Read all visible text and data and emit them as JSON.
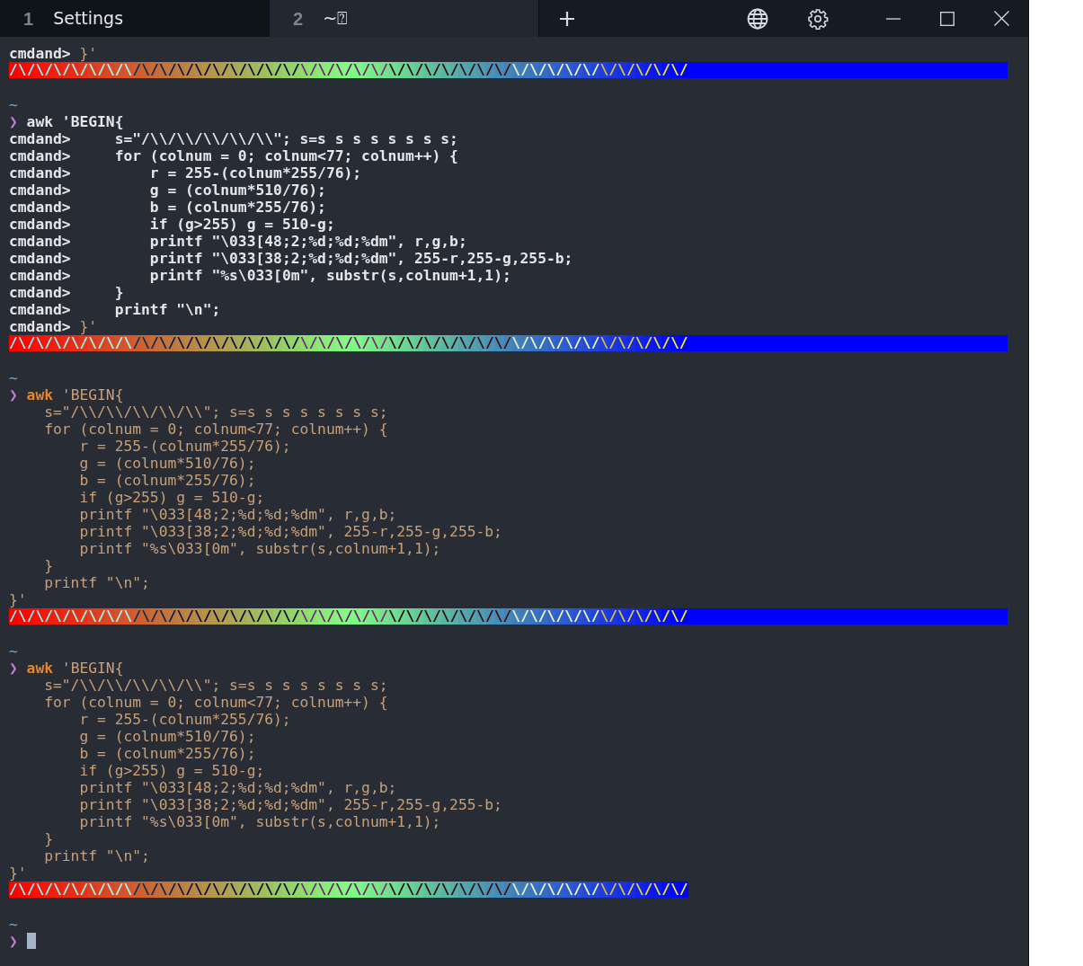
{
  "tabs": [
    {
      "number": "1",
      "title": "Settings",
      "selected": false
    },
    {
      "number": "2",
      "title": "~⍰",
      "selected": true
    }
  ],
  "lines": [
    {
      "kind": "text",
      "segments": [
        {
          "text": "cmdand>",
          "kind": "label"
        },
        {
          "text": " }'",
          "kind": "brace"
        }
      ]
    },
    {
      "kind": "bar",
      "text": "/\\/\\/\\/\\/\\/\\/\\/\\/\\/\\/\\/\\/\\/\\/\\/\\/\\/\\/\\/\\/\\/\\/\\/\\/\\/\\/\\/\\/\\/\\/\\/\\/\\/\\/\\/\\/\\/\\/",
      "fill": true
    },
    {
      "kind": "blank"
    },
    {
      "kind": "text",
      "segments": [
        {
          "text": "~",
          "kind": "dir"
        }
      ]
    },
    {
      "kind": "text",
      "segments": [
        {
          "text": "❯",
          "kind": "chevron"
        },
        {
          "text": " awk 'BEGIN{",
          "kind": "plain"
        }
      ]
    },
    {
      "kind": "text",
      "segments": [
        {
          "text": "cmdand>",
          "kind": "label"
        },
        {
          "text": "     s=\"/\\\\/\\\\/\\\\/\\\\/\\\\\"; s=s s s s s s s s;",
          "kind": "plain"
        }
      ]
    },
    {
      "kind": "text",
      "segments": [
        {
          "text": "cmdand>",
          "kind": "label"
        },
        {
          "text": "     for (colnum = 0; colnum<77; colnum++) {",
          "kind": "plain"
        }
      ]
    },
    {
      "kind": "text",
      "segments": [
        {
          "text": "cmdand>",
          "kind": "label"
        },
        {
          "text": "         r = 255-(colnum*255/76);",
          "kind": "plain"
        }
      ]
    },
    {
      "kind": "text",
      "segments": [
        {
          "text": "cmdand>",
          "kind": "label"
        },
        {
          "text": "         g = (colnum*510/76);",
          "kind": "plain"
        }
      ]
    },
    {
      "kind": "text",
      "segments": [
        {
          "text": "cmdand>",
          "kind": "label"
        },
        {
          "text": "         b = (colnum*255/76);",
          "kind": "plain"
        }
      ]
    },
    {
      "kind": "text",
      "segments": [
        {
          "text": "cmdand>",
          "kind": "label"
        },
        {
          "text": "         if (g>255) g = 510-g;",
          "kind": "plain"
        }
      ]
    },
    {
      "kind": "text",
      "segments": [
        {
          "text": "cmdand>",
          "kind": "label"
        },
        {
          "text": "         printf \"\\033[48;2;%d;%d;%dm\", r,g,b;",
          "kind": "plain"
        }
      ]
    },
    {
      "kind": "text",
      "segments": [
        {
          "text": "cmdand>",
          "kind": "label"
        },
        {
          "text": "         printf \"\\033[38;2;%d;%d;%dm\", 255-r,255-g,255-b;",
          "kind": "plain"
        }
      ]
    },
    {
      "kind": "text",
      "segments": [
        {
          "text": "cmdand>",
          "kind": "label"
        },
        {
          "text": "         printf \"%s\\033[0m\", substr(s,colnum+1,1);",
          "kind": "plain"
        }
      ]
    },
    {
      "kind": "text",
      "segments": [
        {
          "text": "cmdand>",
          "kind": "label"
        },
        {
          "text": "     }",
          "kind": "plain"
        }
      ]
    },
    {
      "kind": "text",
      "segments": [
        {
          "text": "cmdand>",
          "kind": "label"
        },
        {
          "text": "     printf \"\\n\";",
          "kind": "plain"
        }
      ]
    },
    {
      "kind": "text",
      "segments": [
        {
          "text": "cmdand>",
          "kind": "label"
        },
        {
          "text": " }'",
          "kind": "brace"
        }
      ]
    },
    {
      "kind": "bar",
      "text": "/\\/\\/\\/\\/\\/\\/\\/\\/\\/\\/\\/\\/\\/\\/\\/\\/\\/\\/\\/\\/\\/\\/\\/\\/\\/\\/\\/\\/\\/\\/\\/\\/\\/\\/\\/\\/\\/\\/",
      "fill": true
    },
    {
      "kind": "blank"
    },
    {
      "kind": "text",
      "segments": [
        {
          "text": "~",
          "kind": "dir"
        }
      ]
    },
    {
      "kind": "text",
      "segments": [
        {
          "text": "❯",
          "kind": "chevron"
        },
        {
          "text": " awk",
          "kind": "command"
        },
        {
          "text": " 'BEGIN{",
          "kind": "arg"
        }
      ]
    },
    {
      "kind": "text",
      "segments": [
        {
          "text": "    s=\"/\\\\/\\\\/\\\\/\\\\/\\\\\"; s=s s s s s s s s;",
          "kind": "arg"
        }
      ]
    },
    {
      "kind": "text",
      "segments": [
        {
          "text": "    for (colnum = 0; colnum<77; colnum++) {",
          "kind": "arg"
        }
      ]
    },
    {
      "kind": "text",
      "segments": [
        {
          "text": "        r = 255-(colnum*255/76);",
          "kind": "arg"
        }
      ]
    },
    {
      "kind": "text",
      "segments": [
        {
          "text": "        g = (colnum*510/76);",
          "kind": "arg"
        }
      ]
    },
    {
      "kind": "text",
      "segments": [
        {
          "text": "        b = (colnum*255/76);",
          "kind": "arg"
        }
      ]
    },
    {
      "kind": "text",
      "segments": [
        {
          "text": "        if (g>255) g = 510-g;",
          "kind": "arg"
        }
      ]
    },
    {
      "kind": "text",
      "segments": [
        {
          "text": "        printf \"\\033[48;2;%d;%d;%dm\", r,g,b;",
          "kind": "arg"
        }
      ]
    },
    {
      "kind": "text",
      "segments": [
        {
          "text": "        printf \"\\033[38;2;%d;%d;%dm\", 255-r,255-g,255-b;",
          "kind": "arg"
        }
      ]
    },
    {
      "kind": "text",
      "segments": [
        {
          "text": "        printf \"%s\\033[0m\", substr(s,colnum+1,1);",
          "kind": "arg"
        }
      ]
    },
    {
      "kind": "text",
      "segments": [
        {
          "text": "    }",
          "kind": "arg"
        }
      ]
    },
    {
      "kind": "text",
      "segments": [
        {
          "text": "    printf \"\\n\";",
          "kind": "arg"
        }
      ]
    },
    {
      "kind": "text",
      "segments": [
        {
          "text": "}'",
          "kind": "arg"
        }
      ]
    },
    {
      "kind": "bar",
      "text": "/\\/\\/\\/\\/\\/\\/\\/\\/\\/\\/\\/\\/\\/\\/\\/\\/\\/\\/\\/\\/\\/\\/\\/\\/\\/\\/\\/\\/\\/\\/\\/\\/\\/\\/\\/\\/\\/\\/",
      "fill": true
    },
    {
      "kind": "blank"
    },
    {
      "kind": "text",
      "segments": [
        {
          "text": "~",
          "kind": "dir"
        }
      ]
    },
    {
      "kind": "text",
      "segments": [
        {
          "text": "❯",
          "kind": "chevron"
        },
        {
          "text": " awk",
          "kind": "command"
        },
        {
          "text": " 'BEGIN{",
          "kind": "arg"
        }
      ]
    },
    {
      "kind": "text",
      "segments": [
        {
          "text": "    s=\"/\\\\/\\\\/\\\\/\\\\/\\\\\"; s=s s s s s s s s;",
          "kind": "arg"
        }
      ]
    },
    {
      "kind": "text",
      "segments": [
        {
          "text": "    for (colnum = 0; colnum<77; colnum++) {",
          "kind": "arg"
        }
      ]
    },
    {
      "kind": "text",
      "segments": [
        {
          "text": "        r = 255-(colnum*255/76);",
          "kind": "arg"
        }
      ]
    },
    {
      "kind": "text",
      "segments": [
        {
          "text": "        g = (colnum*510/76);",
          "kind": "arg"
        }
      ]
    },
    {
      "kind": "text",
      "segments": [
        {
          "text": "        b = (colnum*255/76);",
          "kind": "arg"
        }
      ]
    },
    {
      "kind": "text",
      "segments": [
        {
          "text": "        if (g>255) g = 510-g;",
          "kind": "arg"
        }
      ]
    },
    {
      "kind": "text",
      "segments": [
        {
          "text": "        printf \"\\033[48;2;%d;%d;%dm\", r,g,b;",
          "kind": "arg"
        }
      ]
    },
    {
      "kind": "text",
      "segments": [
        {
          "text": "        printf \"\\033[38;2;%d;%d;%dm\", 255-r,255-g,255-b;",
          "kind": "arg"
        }
      ]
    },
    {
      "kind": "text",
      "segments": [
        {
          "text": "        printf \"%s\\033[0m\", substr(s,colnum+1,1);",
          "kind": "arg"
        }
      ]
    },
    {
      "kind": "text",
      "segments": [
        {
          "text": "    }",
          "kind": "arg"
        }
      ]
    },
    {
      "kind": "text",
      "segments": [
        {
          "text": "    printf \"\\n\";",
          "kind": "arg"
        }
      ]
    },
    {
      "kind": "text",
      "segments": [
        {
          "text": "}'",
          "kind": "arg"
        }
      ]
    },
    {
      "kind": "bar",
      "text": "/\\/\\/\\/\\/\\/\\/\\/\\/\\/\\/\\/\\/\\/\\/\\/\\/\\/\\/\\/\\/\\/\\/\\/\\/\\/\\/\\/\\/\\/\\/\\/\\/\\/\\/\\/\\/\\/\\/",
      "fill": false
    },
    {
      "kind": "blank"
    },
    {
      "kind": "text",
      "segments": [
        {
          "text": "~",
          "kind": "dir"
        }
      ]
    },
    {
      "kind": "text",
      "segments": [
        {
          "text": "❯",
          "kind": "chevron"
        }
      ],
      "cursor": true
    }
  ]
}
